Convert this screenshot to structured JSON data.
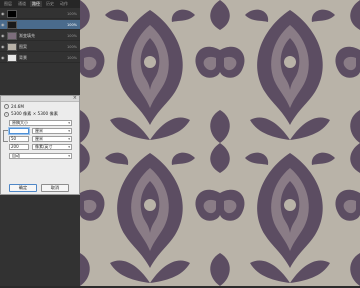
{
  "panel": {
    "tabs": [
      "图层",
      "通道",
      "路径",
      "历史",
      "动作"
    ],
    "active_tab": 2,
    "layers": [
      {
        "name": "",
        "pct": "100%",
        "thumb": "#000000",
        "selected": false
      },
      {
        "name": "",
        "pct": "100%",
        "thumb": "#1a1a1a",
        "selected": true
      },
      {
        "name": "渐变填充",
        "pct": "100%",
        "thumb": "#7d6e7c",
        "selected": false
      },
      {
        "name": "图案",
        "pct": "100%",
        "thumb": "#b8b2a8",
        "selected": false
      },
      {
        "name": "背景",
        "pct": "100%",
        "thumb": "#e8e8e8",
        "selected": false
      }
    ]
  },
  "dialog": {
    "close_glyph": "×",
    "size_label": "24.6M",
    "dims_label": "5300 像素 × 5300 像素",
    "fit_to": "原稿大小",
    "width_value": "",
    "width_unit": "厘米",
    "height_value": "50",
    "height_unit": "厘米",
    "resolution_value": "200",
    "resolution_unit": "像素/英寸",
    "resample": "自动",
    "ok": "确定",
    "cancel": "取消"
  },
  "canvas": {
    "background_color": "#b9b3a8",
    "pattern_color": "#5c4d62",
    "pattern_highlight": "#8a7c86"
  }
}
